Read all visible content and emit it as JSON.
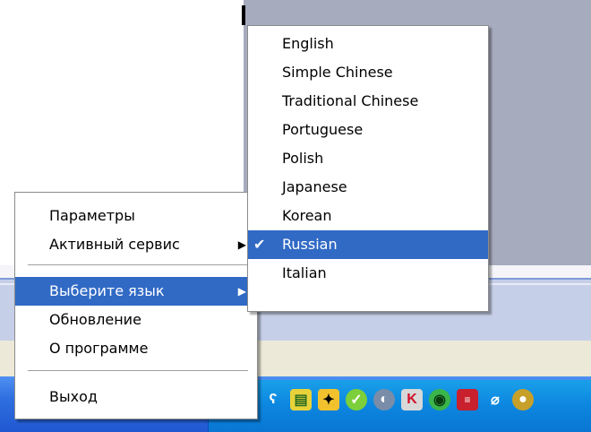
{
  "context_menu": {
    "items": [
      {
        "label": "Параметры"
      },
      {
        "label": "Активный сервис"
      },
      {
        "label": "Выберите язык"
      },
      {
        "label": "Обновление"
      },
      {
        "label": "О программе"
      },
      {
        "label": "Выход"
      }
    ]
  },
  "language_menu": {
    "selected": "Russian",
    "items": [
      {
        "label": "English"
      },
      {
        "label": "Simple Chinese"
      },
      {
        "label": "Traditional Chinese"
      },
      {
        "label": "Portuguese"
      },
      {
        "label": "Polish"
      },
      {
        "label": "Japanese"
      },
      {
        "label": "Korean"
      },
      {
        "label": "Russian"
      },
      {
        "label": "Italian"
      }
    ]
  },
  "tray": {
    "icons": [
      "network-icon",
      "translator-icon",
      "printer-icon",
      "bat-icon",
      "shield-check-icon",
      "speaker-icon",
      "kaspersky-icon",
      "eye-icon",
      "flag-icon",
      "mouse-icon",
      "app-icon"
    ]
  },
  "colors": {
    "highlight": "#316ac5",
    "taskbar": "#2e6fe0",
    "tray": "#0c86df"
  }
}
